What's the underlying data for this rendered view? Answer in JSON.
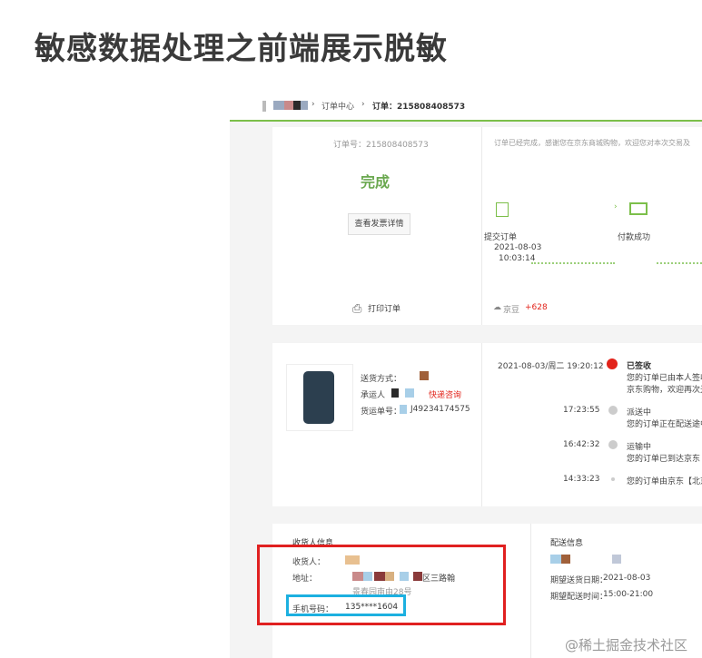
{
  "article": {
    "title": "敏感数据处理之前端展示脱敏"
  },
  "breadcrumb": {
    "sep1": "›",
    "center": "订单中心",
    "sep2": "›",
    "order": "订单：215808408573"
  },
  "order_card": {
    "order_no": "订单号：215808408573",
    "status": "完成",
    "invoice_button": "查看发票详情",
    "print": "打印订单",
    "message": "订单已经完成，感谢您在京东商城购物，欢迎您对本次交易及",
    "step1_label": "提交订单",
    "step1_date": "2021-08-03",
    "step1_time": "10:03:14",
    "step2_label": "付款成功",
    "jingdou_label": "京豆",
    "jingdou_value": "+628"
  },
  "shipping_card": {
    "method_label": "送货方式：",
    "carrier_label": "承运人",
    "express_link": "快递咨询",
    "tracking_label": "货运单号：",
    "tracking_no": "J49234174575",
    "timeline": [
      {
        "time": "2021-08-03/周二  19:20:12",
        "status": "已签收",
        "desc": "您的订单已由本人签收",
        "desc2": "京东购物，欢迎再次光"
      },
      {
        "time": "17:23:55",
        "status": "派送中",
        "desc": "您的订单正在配送途中"
      },
      {
        "time": "16:42:32",
        "status": "运输中",
        "desc": "您的订单已到达京东【"
      },
      {
        "time": "14:33:23",
        "status": "",
        "desc": "您的订单由京东【北京"
      }
    ]
  },
  "receiver_card": {
    "section_title": "收货人信息",
    "name_label": "收货人：",
    "address_label": "地址：",
    "address_tail": "区三路翰",
    "address_line2": "景春园南由28号",
    "phone_label": "手机号码：",
    "phone_value": "135****1604",
    "delivery_title": "配送信息",
    "delivery_date_label": "期望送货日期：",
    "delivery_date": "2021-08-03",
    "delivery_time_label": "期望配送时间：",
    "delivery_time": "15:00-21:00"
  },
  "watermark": "@稀土掘金技术社区",
  "colors": {
    "accent_green": "#7cbf4a",
    "highlight_red": "#e02020",
    "highlight_blue": "#1cb0e0"
  }
}
